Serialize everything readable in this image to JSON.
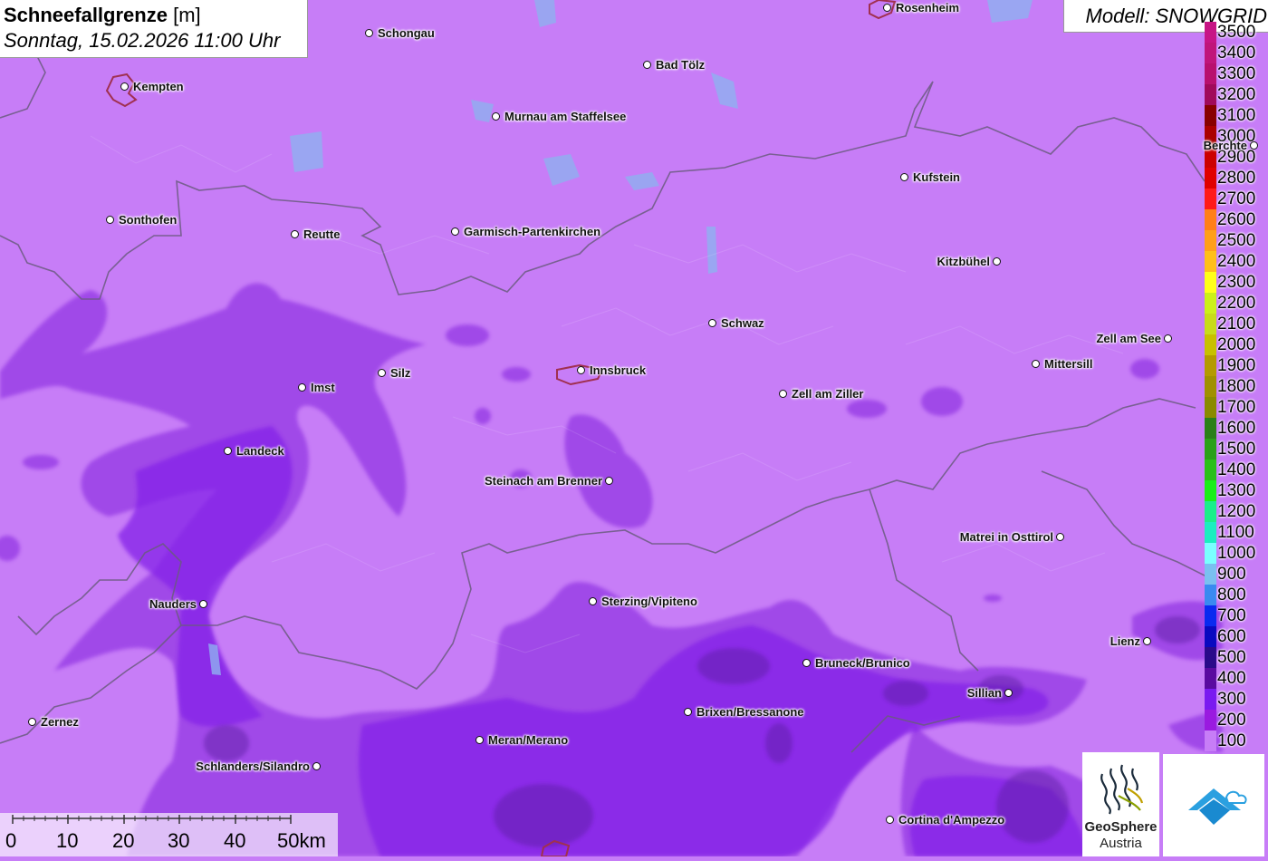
{
  "title": {
    "parameter": "Schneefallgrenze",
    "unit": "[m]",
    "datetime": "Sonntag, 15.02.2026 11:00 Uhr"
  },
  "model": "Modell: SNOWGRID",
  "legend": {
    "items": [
      {
        "label": "3500",
        "color": "#c71585"
      },
      {
        "label": "3400",
        "color": "#c0157a"
      },
      {
        "label": "3300",
        "color": "#b8106e"
      },
      {
        "label": "3200",
        "color": "#a00a5a"
      },
      {
        "label": "3100",
        "color": "#880000"
      },
      {
        "label": "3000",
        "color": "#aa0000"
      },
      {
        "label": "2900",
        "color": "#cc0000"
      },
      {
        "label": "2800",
        "color": "#e00000"
      },
      {
        "label": "2700",
        "color": "#ff1a1a"
      },
      {
        "label": "2600",
        "color": "#ff7f1a"
      },
      {
        "label": "2500",
        "color": "#ff9f1a"
      },
      {
        "label": "2400",
        "color": "#ffbf1a"
      },
      {
        "label": "2300",
        "color": "#ffff1a"
      },
      {
        "label": "2200",
        "color": "#ccf01a"
      },
      {
        "label": "2100",
        "color": "#c8dc1a"
      },
      {
        "label": "2000",
        "color": "#c8c000"
      },
      {
        "label": "1900",
        "color": "#b49a00"
      },
      {
        "label": "1800",
        "color": "#a09000"
      },
      {
        "label": "1700",
        "color": "#8a8a00"
      },
      {
        "label": "1600",
        "color": "#2a7f1a"
      },
      {
        "label": "1500",
        "color": "#2aa01a"
      },
      {
        "label": "1400",
        "color": "#2abf1a"
      },
      {
        "label": "1300",
        "color": "#1aef1a"
      },
      {
        "label": "1200",
        "color": "#1aef8a"
      },
      {
        "label": "1100",
        "color": "#1aefc0"
      },
      {
        "label": "1000",
        "color": "#7affff"
      },
      {
        "label": "900",
        "color": "#7ac0f0"
      },
      {
        "label": "800",
        "color": "#3a8af0"
      },
      {
        "label": "700",
        "color": "#0a2af0"
      },
      {
        "label": "600",
        "color": "#0a0ac0"
      },
      {
        "label": "500",
        "color": "#2a0a8a"
      },
      {
        "label": "400",
        "color": "#5a0aa0"
      },
      {
        "label": "300",
        "color": "#7a1af0"
      },
      {
        "label": "200",
        "color": "#9a1ae0"
      },
      {
        "label": "100",
        "color": "#c77df7"
      }
    ]
  },
  "cities": [
    {
      "name": "Rosenheim",
      "side": "right"
    },
    {
      "name": "Schongau",
      "side": "right"
    },
    {
      "name": "Bad Tölz",
      "side": "right"
    },
    {
      "name": "Kempten",
      "side": "right"
    },
    {
      "name": "Murnau am Staffelsee",
      "side": "right"
    },
    {
      "name": "Berchte",
      "side": "left"
    },
    {
      "name": "Kufstein",
      "side": "right"
    },
    {
      "name": "Sonthofen",
      "side": "right"
    },
    {
      "name": "Reutte",
      "side": "right"
    },
    {
      "name": "Garmisch-Partenkirchen",
      "side": "right"
    },
    {
      "name": "Kitzbühel",
      "side": "left"
    },
    {
      "name": "Schwaz",
      "side": "right"
    },
    {
      "name": "Zell am See",
      "side": "left"
    },
    {
      "name": "Mittersill",
      "side": "right"
    },
    {
      "name": "Imst",
      "side": "right"
    },
    {
      "name": "Silz",
      "side": "right"
    },
    {
      "name": "Innsbruck",
      "side": "right"
    },
    {
      "name": "Zell am Ziller",
      "side": "right"
    },
    {
      "name": "Landeck",
      "side": "right"
    },
    {
      "name": "Steinach am Brenner",
      "side": "left"
    },
    {
      "name": "Matrei in Osttirol",
      "side": "left"
    },
    {
      "name": "Nauders",
      "side": "left"
    },
    {
      "name": "Sterzing/Vipiteno",
      "side": "right"
    },
    {
      "name": "Lienz",
      "side": "left"
    },
    {
      "name": "Bruneck/Brunico",
      "side": "right"
    },
    {
      "name": "Sillian",
      "side": "left"
    },
    {
      "name": "Brixen/Bressanone",
      "side": "right"
    },
    {
      "name": "Zernez",
      "side": "right"
    },
    {
      "name": "Meran/Merano",
      "side": "right"
    },
    {
      "name": "Schlanders/Silandro",
      "side": "left"
    },
    {
      "name": "Cortina d'Ampezzo",
      "side": "right"
    }
  ],
  "scalebar": {
    "labels": [
      "0",
      "10",
      "20",
      "30",
      "40",
      "50km"
    ]
  },
  "logos": {
    "geosphere_line1": "GeoSphere",
    "geosphere_line2": "Austria"
  }
}
